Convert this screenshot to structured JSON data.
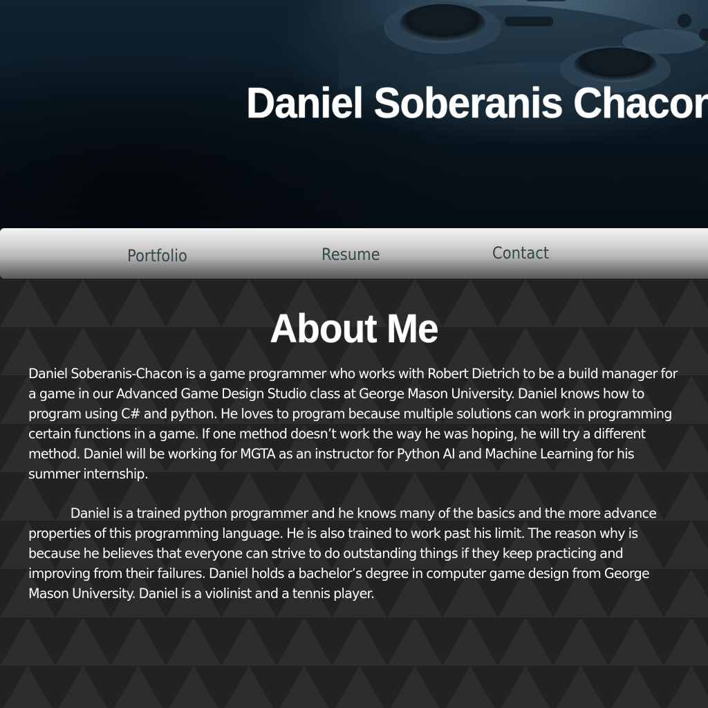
{
  "header": {
    "title": "Daniel Soberanis Chacon"
  },
  "nav": {
    "items": [
      {
        "label": "Portfolio"
      },
      {
        "label": "Resume"
      },
      {
        "label": "Contact"
      }
    ]
  },
  "about": {
    "heading": "About Me",
    "paragraphs": [
      "Daniel Soberanis-Chacon is a game programmer who works with Robert Dietrich to be a build manager for a game in our Advanced Game Design Studio class at George Mason University. Daniel knows how to program using C# and python. He loves to program because multiple solutions can work in programming certain functions in a game. If one method doesn’t work the way he was hoping, he will try a different method. Daniel will be working for MGTA as an instructor for Python AI and Machine Learning for his summer internship.",
      "Daniel is a trained python programmer and he knows many of the basics and the more advance properties of this programming language. He is also trained to work past his limit. The reason why is because he believes that everyone can strive to do outstanding things if they keep practicing and improving from their failures. Daniel holds a bachelor’s degree in computer game design from George Mason University. Daniel is a violinist and a tennis player."
    ]
  },
  "images": {
    "banner": "game-controller-photo"
  },
  "colors": {
    "header_bg": "#0a1822",
    "nav_text": "#34464c",
    "body_bg": "#242424",
    "text": "#ffffff"
  }
}
